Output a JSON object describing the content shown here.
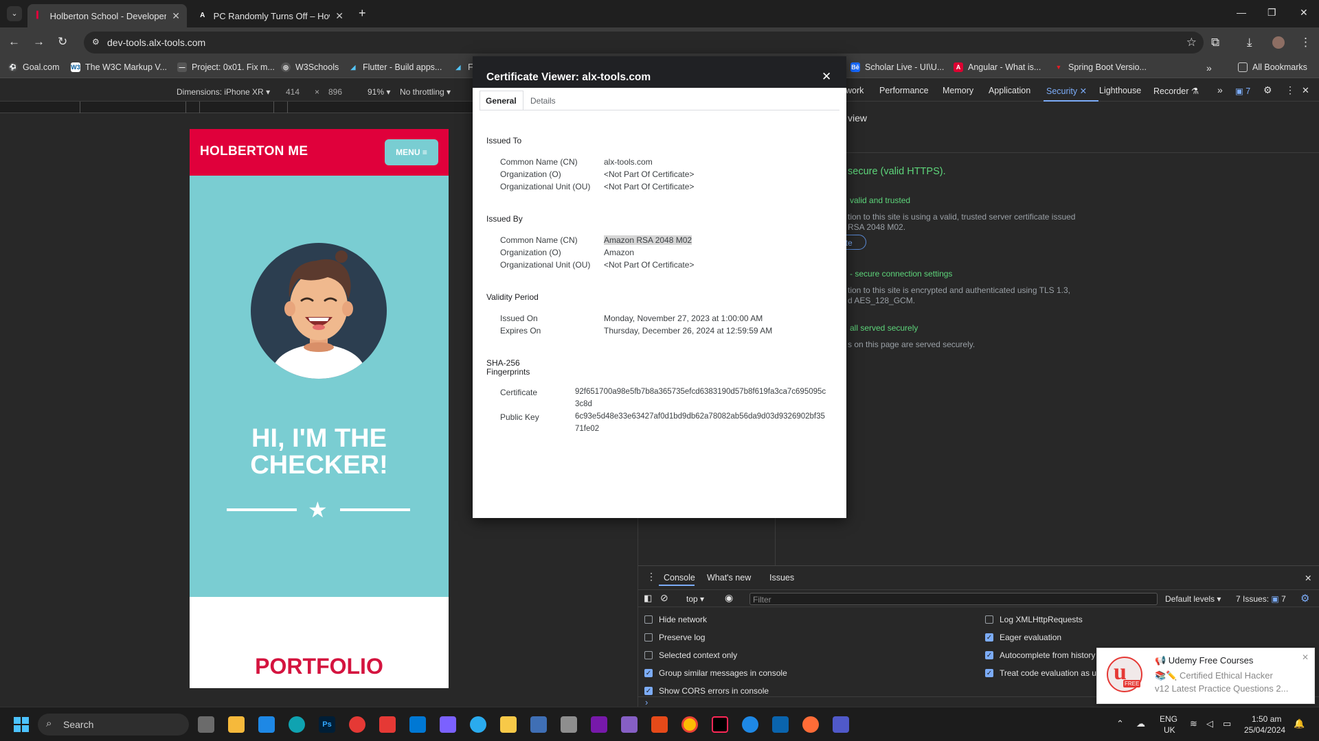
{
  "browser": {
    "tabs": [
      {
        "title": "Holberton School - Developer",
        "active": true
      },
      {
        "title": "PC Randomly Turns Off – How",
        "active": false
      }
    ],
    "new_tab": "+",
    "url": "dev-tools.alx-tools.com",
    "bookmarks": [
      "Goal.com",
      "The W3C Markup V...",
      "Project: 0x01. Fix m...",
      "W3Schools",
      "Flutter - Build apps...",
      "F",
      "Scholar Live - UI\\U...",
      "Angular - What is...",
      "Spring Boot Versio..."
    ],
    "all_bookmarks": "All Bookmarks",
    "overflow": "»"
  },
  "device_toolbar": {
    "dimensions": "Dimensions: iPhone XR",
    "width": "414",
    "times": "×",
    "height": "896",
    "zoom": "91%",
    "throttling": "No throttling"
  },
  "phone": {
    "logo": "HOLBERTON ME",
    "menu": "MENU ≡",
    "title_line1": "HI, I'M THE",
    "title_line2": "CHECKER!",
    "portfolio": "PORTFOLIO",
    "star": "★"
  },
  "devtools": {
    "tabs": [
      "work",
      "Performance",
      "Memory",
      "Application",
      "Security",
      "Lighthouse",
      "Recorder ⚗"
    ],
    "issues_badge": "7",
    "security": {
      "heading": "view",
      "secure_main": "secure (valid HTTPS).",
      "cert_title": "valid and trusted",
      "cert_desc1": "tion to this site is using a valid, trusted server certificate issued",
      "cert_desc2": "RSA 2048 M02.",
      "view_cert": "tificate",
      "conn_title": "- secure connection settings",
      "conn_desc1": "tion to this site is encrypted and authenticated using TLS 1.3,",
      "conn_desc2": "d AES_128_GCM.",
      "res_title": "all served securely",
      "res_desc": "s on this page are served securely."
    },
    "drawer": {
      "tabs": [
        "Console",
        "What's new",
        "Issues"
      ],
      "context": "top",
      "filter_placeholder": "Filter",
      "levels": "Default levels",
      "issues": "7 Issues:",
      "issues_count": "7",
      "settings_left": [
        {
          "label": "Hide network",
          "checked": false
        },
        {
          "label": "Preserve log",
          "checked": false
        },
        {
          "label": "Selected context only",
          "checked": false
        },
        {
          "label": "Group similar messages in console",
          "checked": true
        },
        {
          "label": "Show CORS errors in console",
          "checked": true
        }
      ],
      "settings_right": [
        {
          "label": "Log XMLHttpRequests",
          "checked": false
        },
        {
          "label": "Eager evaluation",
          "checked": true
        },
        {
          "label": "Autocomplete from history",
          "checked": true
        },
        {
          "label": "Treat code evaluation as us",
          "checked": true
        }
      ],
      "prompt": "›"
    }
  },
  "cert_dialog": {
    "title": "Certificate Viewer: alx-tools.com",
    "tabs": [
      "General",
      "Details"
    ],
    "issued_to": {
      "heading": "Issued To",
      "rows": [
        {
          "k": "Common Name (CN)",
          "v": "alx-tools.com"
        },
        {
          "k": "Organization (O)",
          "v": "<Not Part Of Certificate>"
        },
        {
          "k": "Organizational Unit (OU)",
          "v": "<Not Part Of Certificate>"
        }
      ]
    },
    "issued_by": {
      "heading": "Issued By",
      "rows": [
        {
          "k": "Common Name (CN)",
          "v": "Amazon RSA 2048 M02"
        },
        {
          "k": "Organization (O)",
          "v": "Amazon"
        },
        {
          "k": "Organizational Unit (OU)",
          "v": "<Not Part Of Certificate>"
        }
      ]
    },
    "validity": {
      "heading": "Validity Period",
      "rows": [
        {
          "k": "Issued On",
          "v": "Monday, November 27, 2023 at 1:00:00 AM"
        },
        {
          "k": "Expires On",
          "v": "Thursday, December 26, 2024 at 12:59:59 AM"
        }
      ]
    },
    "fingerprints": {
      "heading1": "SHA-256",
      "heading2": "Fingerprints",
      "cert_label": "Certificate",
      "cert_1": "92f651700a98e5fb7b8a365735efcd6383190d57b8f619fa3ca7c695095c",
      "cert_2": "3c8d",
      "pk_label": "Public Key",
      "pk_1": "6c93e5d48e33e63427af0d1bd9db62a78082ab56da9d03d9326902bf35",
      "pk_2": "71fe02"
    }
  },
  "toast": {
    "title": "📢 Udemy Free Courses",
    "line1": "📚✏️ Certified Ethical Hacker",
    "line2": "v12 Latest Practice Questions 2...",
    "badge": "FREE"
  },
  "taskbar": {
    "search": "Search",
    "lang1": "ENG",
    "lang2": "UK",
    "time": "1:50 am",
    "date": "25/04/2024"
  }
}
